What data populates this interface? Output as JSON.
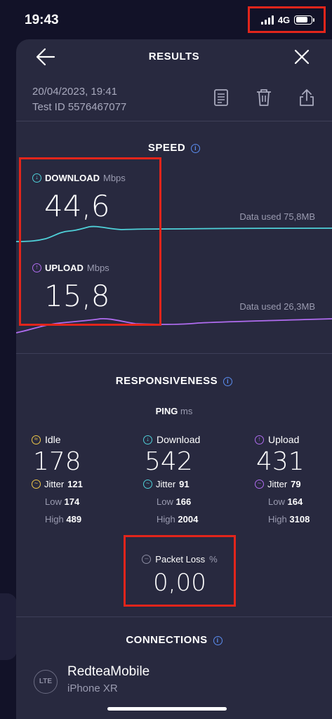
{
  "status": {
    "time": "19:43",
    "network": "4G"
  },
  "header": {
    "title": "RESULTS"
  },
  "test": {
    "datetime": "20/04/2023, 19:41",
    "test_id": "Test ID 5576467077"
  },
  "speed": {
    "title": "SPEED",
    "download": {
      "label": "DOWNLOAD",
      "unit": "Mbps",
      "value": "44,6",
      "data_used": "Data used 75,8MB"
    },
    "upload": {
      "label": "UPLOAD",
      "unit": "Mbps",
      "value": "15,8",
      "data_used": "Data used 26,3MB"
    }
  },
  "responsiveness": {
    "title": "RESPONSIVENESS",
    "ping_label": "PING",
    "ping_unit": "ms",
    "low_label": "Low",
    "high_label": "High",
    "jitter_label": "Jitter",
    "columns": [
      {
        "label": "Idle",
        "value": "178",
        "jitter": "121",
        "low": "174",
        "high": "489"
      },
      {
        "label": "Download",
        "value": "542",
        "jitter": "91",
        "low": "166",
        "high": "2004"
      },
      {
        "label": "Upload",
        "value": "431",
        "jitter": "79",
        "low": "164",
        "high": "3108"
      }
    ],
    "packet_loss": {
      "label": "Packet Loss",
      "unit": "%",
      "value": "0,00"
    }
  },
  "connections": {
    "title": "CONNECTIONS",
    "provider": "RedteaMobile",
    "device": "iPhone XR",
    "logo_text": "LTE"
  },
  "colors": {
    "download": "#4fd1d9",
    "upload": "#b06cf0",
    "idle": "#f0c848",
    "highlight": "#e2251b",
    "info": "#5b8df0"
  }
}
